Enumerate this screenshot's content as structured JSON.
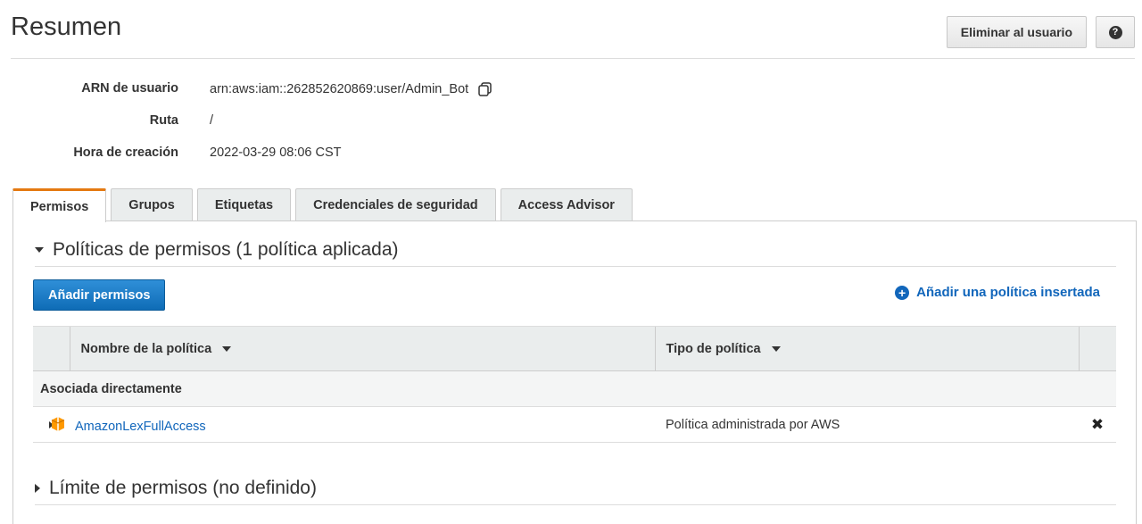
{
  "header": {
    "title": "Resumen",
    "delete_user_label": "Eliminar al usuario",
    "help_icon": "help-circle-icon"
  },
  "summary": {
    "arn_label": "ARN de usuario",
    "arn_value": "arn:aws:iam::262852620869:user/Admin_Bot",
    "path_label": "Ruta",
    "path_value": "/",
    "created_label": "Hora de creación",
    "created_value": "2022-03-29 08:06 CST"
  },
  "tabs": [
    {
      "label": "Permisos",
      "active": true
    },
    {
      "label": "Grupos"
    },
    {
      "label": "Etiquetas"
    },
    {
      "label": "Credenciales de seguridad"
    },
    {
      "label": "Access Advisor"
    }
  ],
  "permissions": {
    "section_title": "Políticas de permisos (1 política aplicada)",
    "add_button": "Añadir permisos",
    "inline_link": "Añadir una política insertada",
    "table": {
      "col_name": "Nombre de la política",
      "col_type": "Tipo de política",
      "group_label": "Asociada directamente",
      "rows": [
        {
          "name": "AmazonLexFullAccess",
          "type": "Política administrada por AWS"
        }
      ]
    }
  },
  "boundary": {
    "section_title": "Límite de permisos (no definido)"
  },
  "colors": {
    "accent_tab": "#e47911",
    "link": "#1166bb",
    "primary_button": "#1f7fcc",
    "policy_icon": "#f90"
  }
}
